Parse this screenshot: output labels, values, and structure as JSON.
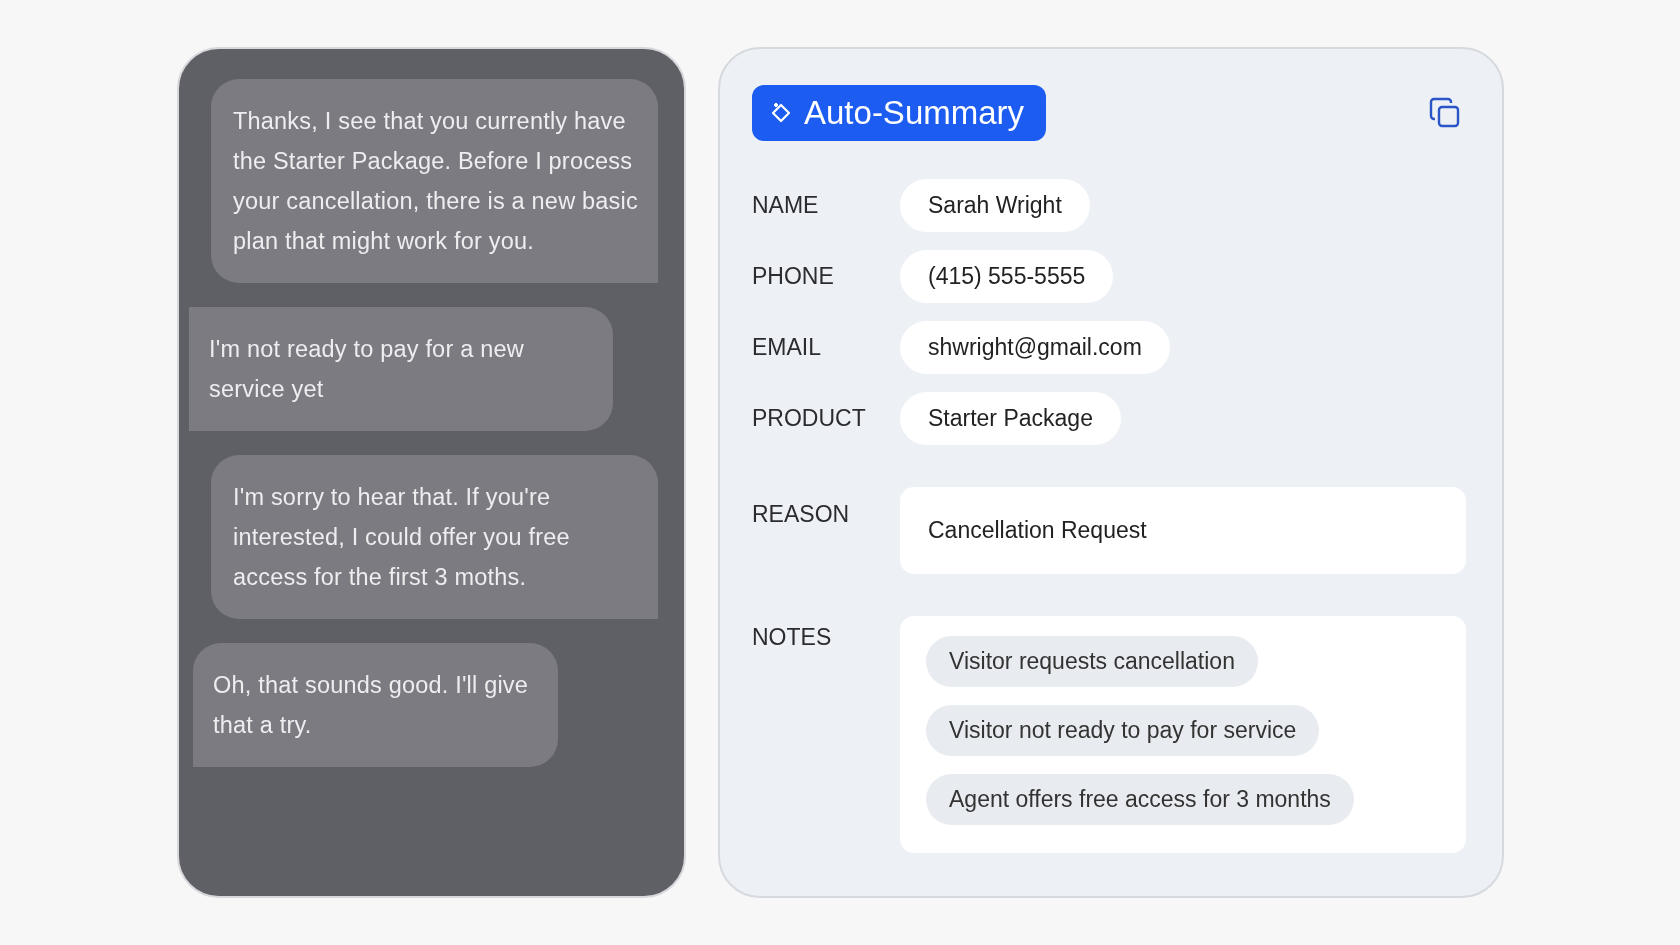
{
  "chat": {
    "messages": [
      {
        "kind": "agent",
        "text": "Thanks, I see that you currently have the Starter Package. Before I process your cancellation, there is a new basic plan that might work for you."
      },
      {
        "kind": "visitor",
        "text": "I'm not ready to pay for a new service yet"
      },
      {
        "kind": "agent",
        "text": "I'm sorry to hear that. If you're interested, I could offer you free access for the first 3 moths."
      },
      {
        "kind": "visitor",
        "text": "Oh, that sounds good. I'll give that a try."
      }
    ]
  },
  "summary": {
    "title": "Auto-Summary",
    "fields": [
      {
        "label": "NAME",
        "value": "Sarah Wright"
      },
      {
        "label": "PHONE",
        "value": "(415) 555-5555"
      },
      {
        "label": "EMAIL",
        "value": "shwright@gmail.com"
      },
      {
        "label": "PRODUCT",
        "value": "Starter Package"
      }
    ],
    "reason": {
      "label": "REASON",
      "value": "Cancellation Request"
    },
    "notes": {
      "label": "NOTES",
      "items": [
        "Visitor requests cancellation",
        "Visitor not ready to pay for service",
        "Agent offers free access for 3 months"
      ]
    }
  }
}
